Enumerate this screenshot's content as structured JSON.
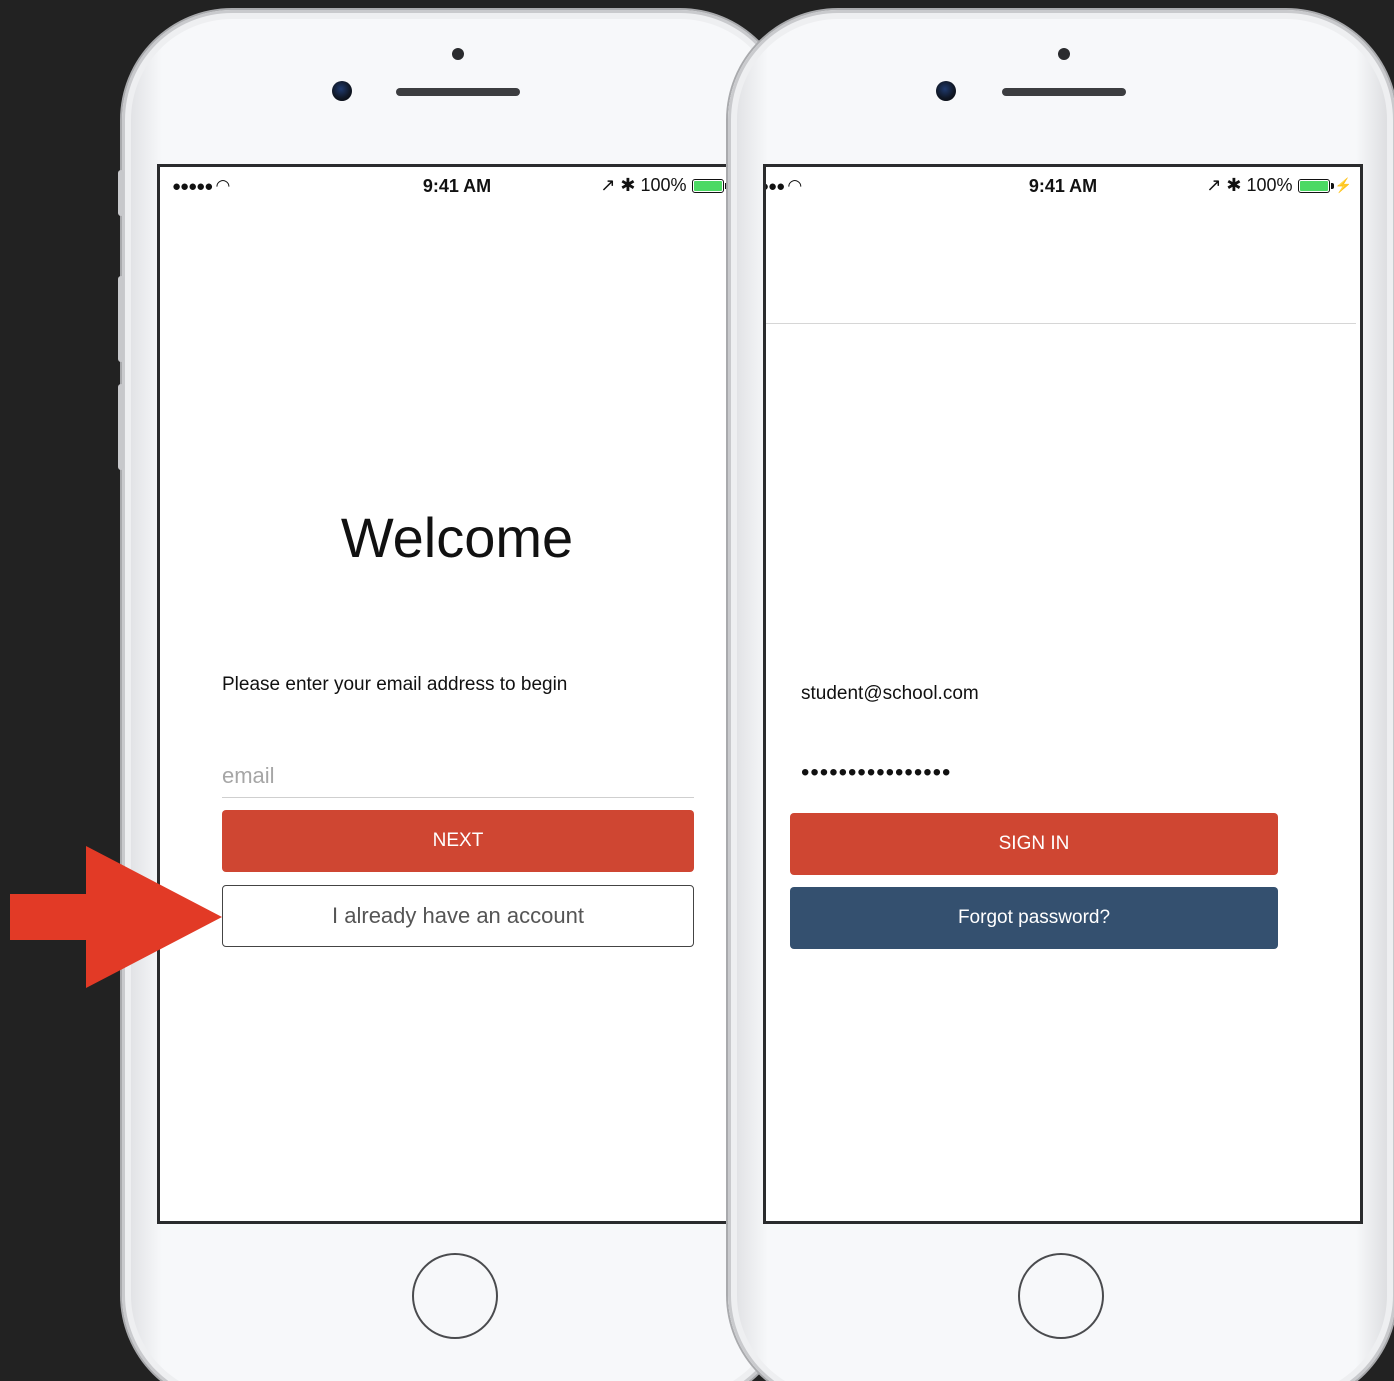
{
  "status_bar": {
    "signal": "●●●●● ",
    "signal_right": "●●● ",
    "time": "9:41 AM",
    "battery_text": "100%",
    "battery_level": 1.0
  },
  "welcome_screen": {
    "title": "Welcome",
    "prompt": "Please enter your email address to begin",
    "email_placeholder": "email",
    "next_button": "NEXT",
    "account_button": "I already have an account"
  },
  "signin_screen": {
    "back_icon": "chevron-left-icon",
    "email_value": "student@school.com",
    "password_masked": "••••••••••••••••",
    "signin_button": "SIGN IN",
    "forgot_button": "Forgot password?"
  },
  "colors": {
    "primary_red": "#cf4632",
    "navy": "#34506f",
    "arrow_red": "#e23a26",
    "link_blue": "#2f7be6",
    "battery_green": "#4cd964"
  },
  "annotation": {
    "arrow_icon": "arrow-right-icon"
  }
}
